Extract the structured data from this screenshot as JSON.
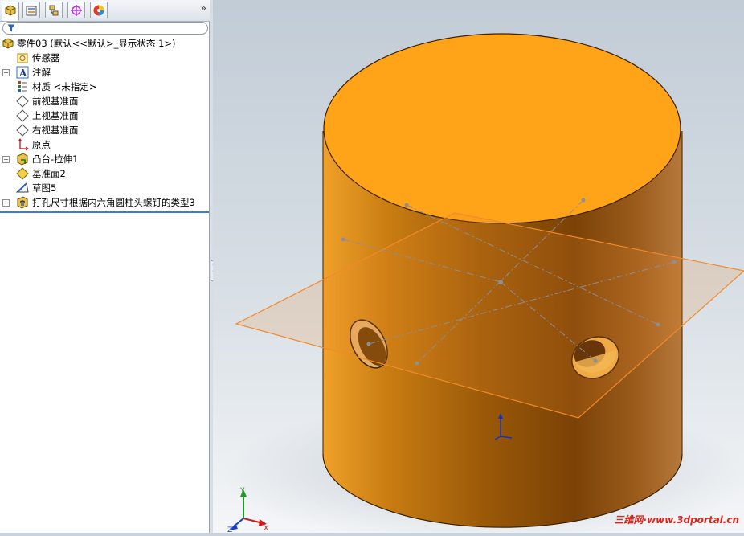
{
  "feature_tree": {
    "root_label": "零件03   (默认<<默认>_显示状态 1>)",
    "items": [
      {
        "label": "传感器",
        "icon": "sensor-icon",
        "expandable": false
      },
      {
        "label": "注解",
        "icon": "annotation-icon",
        "expandable": true
      },
      {
        "label": "材质 <未指定>",
        "icon": "material-icon",
        "expandable": false
      },
      {
        "label": "前视基准面",
        "icon": "plane-icon",
        "expandable": false
      },
      {
        "label": "上视基准面",
        "icon": "plane-icon",
        "expandable": false
      },
      {
        "label": "右视基准面",
        "icon": "plane-icon",
        "expandable": false
      },
      {
        "label": "原点",
        "icon": "origin-icon",
        "expandable": false
      },
      {
        "label": "凸台-拉伸1",
        "icon": "boss-extrude-icon",
        "expandable": true
      },
      {
        "label": "基准面2",
        "icon": "plane-icon",
        "expandable": false
      },
      {
        "label": "草图5",
        "icon": "sketch-icon",
        "expandable": false
      },
      {
        "label": "打孔尺寸根据内六角圆柱头螺钉的类型3",
        "icon": "hole-wizard-icon",
        "expandable": true
      }
    ]
  },
  "tabs": [
    "feature-manager",
    "property-manager",
    "configuration-manager",
    "dimxpert-manager",
    "display-manager"
  ],
  "tab_expand_label": "»",
  "watermark": "三维网·www.3dportal.cn",
  "triad": {
    "x": "X",
    "y": "Y",
    "z": "Z"
  },
  "colors": {
    "part": "#f5a00e",
    "plane": "#f08a2a",
    "selection": "#3a7bd5"
  }
}
